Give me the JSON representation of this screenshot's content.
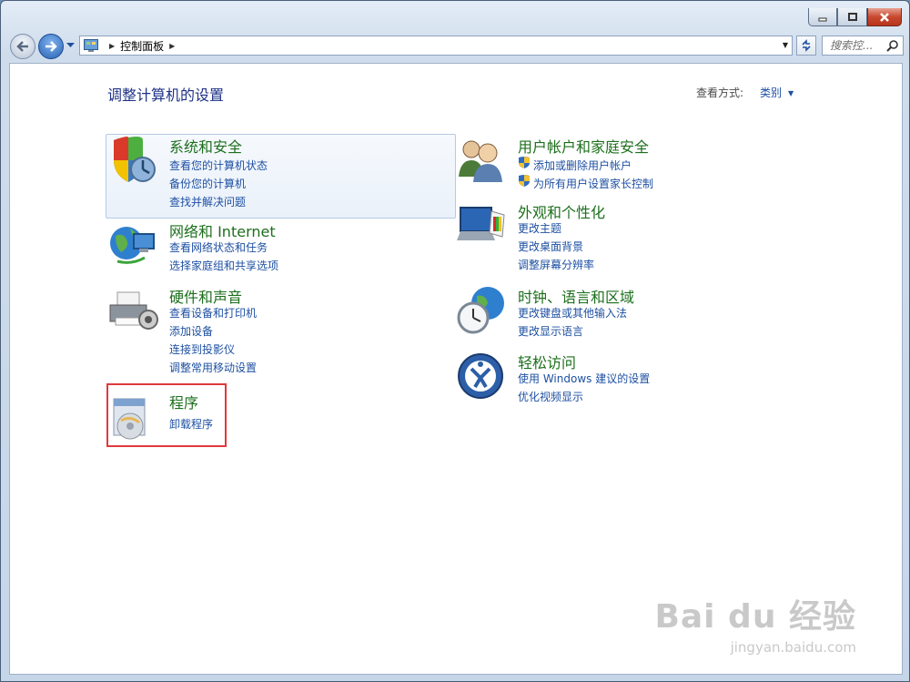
{
  "window": {
    "controls": {
      "minimize": "minimize",
      "maximize": "maximize",
      "close": "close"
    }
  },
  "address_bar": {
    "path": [
      "控制面板"
    ],
    "search_placeholder": "搜索控..."
  },
  "page": {
    "title": "调整计算机的设置",
    "view_by_label": "查看方式:",
    "view_by_value": "类别"
  },
  "categories": {
    "system_security": {
      "title": "系统和安全",
      "links": [
        "查看您的计算机状态",
        "备份您的计算机",
        "查找并解决问题"
      ]
    },
    "network": {
      "title": "网络和 Internet",
      "links": [
        "查看网络状态和任务",
        "选择家庭组和共享选项"
      ]
    },
    "hardware": {
      "title": "硬件和声音",
      "links": [
        "查看设备和打印机",
        "添加设备",
        "连接到投影仪",
        "调整常用移动设置"
      ]
    },
    "programs": {
      "title": "程序",
      "links": [
        "卸载程序"
      ]
    },
    "user_accounts": {
      "title": "用户帐户和家庭安全",
      "links": [
        "添加或删除用户帐户",
        "为所有用户设置家长控制"
      ]
    },
    "appearance": {
      "title": "外观和个性化",
      "links": [
        "更改主题",
        "更改桌面背景",
        "调整屏幕分辨率"
      ]
    },
    "clock": {
      "title": "时钟、语言和区域",
      "links": [
        "更改键盘或其他输入法",
        "更改显示语言"
      ]
    },
    "ease": {
      "title": "轻松访问",
      "links": [
        "使用 Windows 建议的设置",
        "优化视频显示"
      ]
    }
  },
  "watermark": {
    "brand": "Bai du 经验",
    "url": "jingyan.baidu.com"
  },
  "colors": {
    "title_green": "#1c6f1c",
    "link_blue": "#1e50a2",
    "highlight_red": "#e0393b"
  }
}
